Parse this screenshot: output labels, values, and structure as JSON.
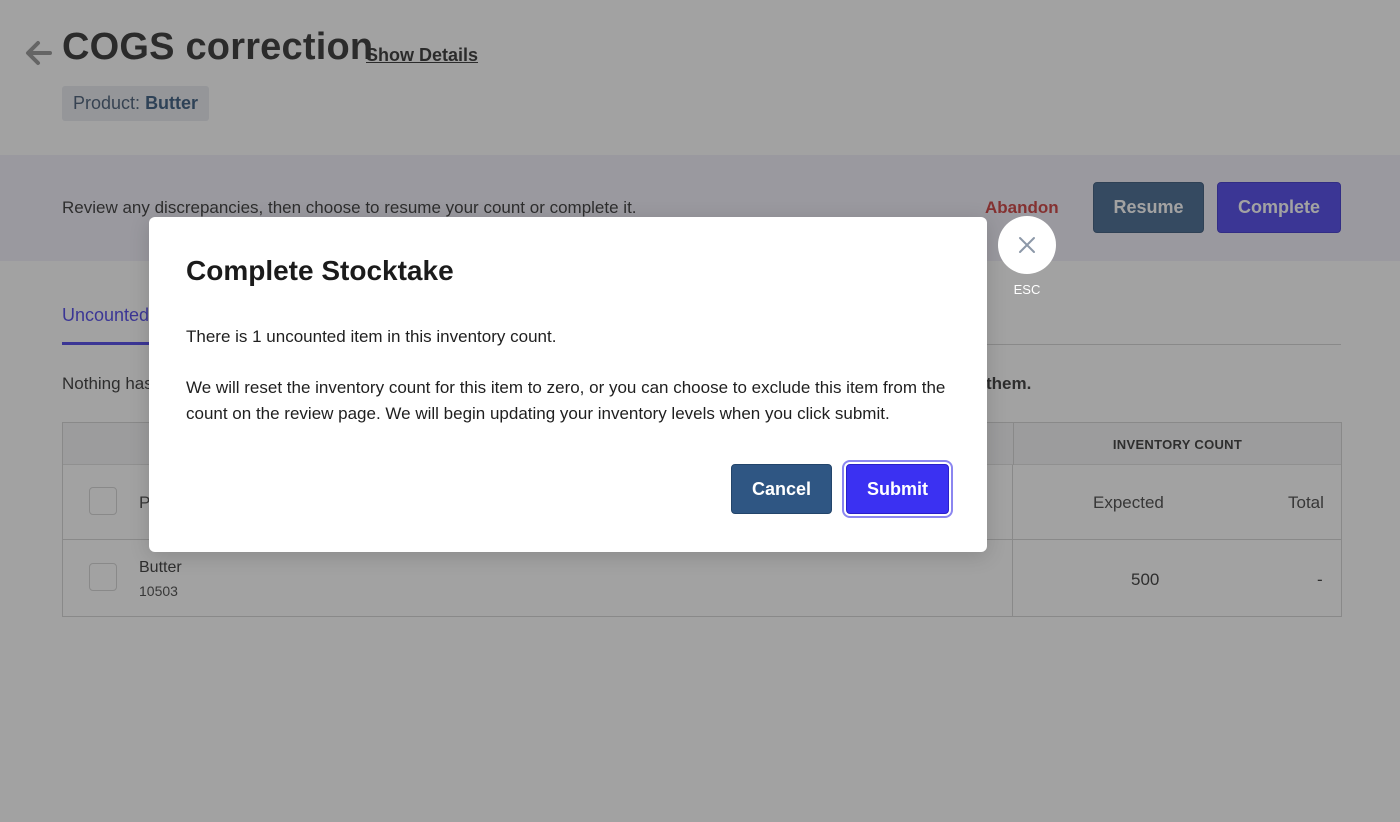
{
  "header": {
    "title": "COGS correction",
    "show_details": "Show Details",
    "product_prefix": "Product:",
    "product_name": "Butter"
  },
  "action_bar": {
    "text": "Review any discrepancies, then choose to resume your count or complete it.",
    "abandon": "Abandon",
    "resume": "Resume",
    "complete": "Complete"
  },
  "tabs": {
    "active": "Uncounted"
  },
  "notice": {
    "start": "Nothing has",
    "end": "them."
  },
  "table": {
    "group_header": "INVENTORY COUNT",
    "columns": {
      "product": "P",
      "expected": "Expected",
      "total": "Total"
    },
    "rows": [
      {
        "name": "Butter",
        "code": "10503",
        "expected": "500",
        "total": "-"
      }
    ]
  },
  "modal": {
    "title": "Complete Stocktake",
    "paragraph1": "There is 1 uncounted item in this inventory count.",
    "paragraph2": "We will reset the inventory count for this item to zero, or you can choose to exclude this item from the count on the review page. We will begin updating your inventory levels when you click submit.",
    "cancel": "Cancel",
    "submit": "Submit",
    "close_hint": "ESC"
  },
  "colors": {
    "primary": "#3b31e6",
    "secondary": "#2f5683",
    "danger": "#c62828"
  },
  "icons": {
    "back": "arrow-left-icon",
    "close": "close-icon"
  }
}
